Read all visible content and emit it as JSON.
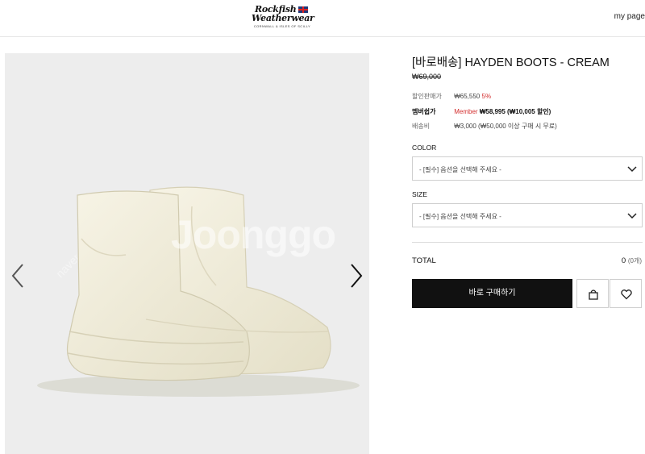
{
  "header": {
    "logo_line1": "Rockfish",
    "logo_line2": "Weatherwear",
    "logo_tagline": "CORNWALL & ISLES OF SCILLY",
    "my_page": "my page"
  },
  "gallery": {
    "watermark": "Joonggo",
    "watermark_diag": "naver.com/joonggonara"
  },
  "product": {
    "title": "[바로배송] HAYDEN BOOTS - CREAM",
    "original_price": "₩69,000",
    "sale_label": "할인판매가",
    "sale_price": "₩65,550",
    "sale_rate": "5%",
    "member_label": "멤버쉽가",
    "member_prefix": "Member",
    "member_price": "₩58,995 (₩10,005 할인)",
    "shipping_label": "배송비",
    "shipping_value": "₩3,000 (₩50,000 이상 구매 시 무료)"
  },
  "options": {
    "color_label": "COLOR",
    "color_placeholder": "- [필수] 옵션을 선택해 주세요 -",
    "size_label": "SIZE",
    "size_placeholder": "- [필수] 옵션을 선택해 주세요 -"
  },
  "total": {
    "label": "TOTAL",
    "amount": "0",
    "count": "(0개)"
  },
  "actions": {
    "buy_now": "바로 구매하기"
  },
  "colors": {
    "boot": "#f3efdc",
    "accent_red": "#d32f2f",
    "button_black": "#111111"
  }
}
